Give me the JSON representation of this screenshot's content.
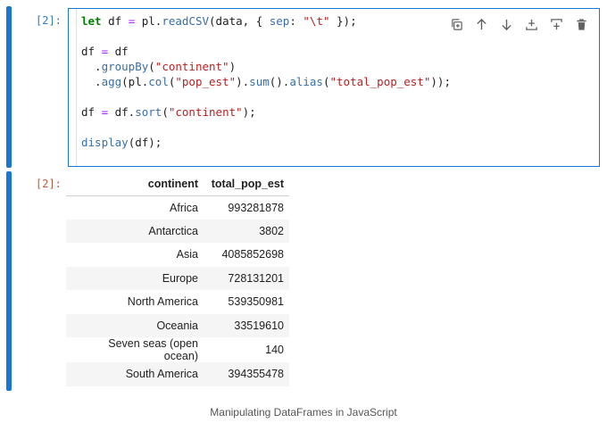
{
  "input_cell": {
    "prompt": "[2]:",
    "code_lines": [
      [
        {
          "t": "let",
          "c": "kw"
        },
        {
          "t": " df "
        },
        {
          "t": "=",
          "c": "op"
        },
        {
          "t": " pl."
        },
        {
          "t": "readCSV",
          "c": "fn"
        },
        {
          "t": "(data, { "
        },
        {
          "t": "sep",
          "c": "fn"
        },
        {
          "t": ": "
        },
        {
          "t": "\"\\t\"",
          "c": "st"
        },
        {
          "t": " });"
        }
      ],
      [
        {
          "t": ""
        }
      ],
      [
        {
          "t": "df "
        },
        {
          "t": "=",
          "c": "op"
        },
        {
          "t": " df"
        }
      ],
      [
        {
          "t": "  ."
        },
        {
          "t": "groupBy",
          "c": "fn"
        },
        {
          "t": "("
        },
        {
          "t": "\"continent\"",
          "c": "st"
        },
        {
          "t": ")"
        }
      ],
      [
        {
          "t": "  ."
        },
        {
          "t": "agg",
          "c": "fn"
        },
        {
          "t": "(pl."
        },
        {
          "t": "col",
          "c": "fn"
        },
        {
          "t": "("
        },
        {
          "t": "\"pop_est\"",
          "c": "st"
        },
        {
          "t": ")."
        },
        {
          "t": "sum",
          "c": "fn"
        },
        {
          "t": "()."
        },
        {
          "t": "alias",
          "c": "fn"
        },
        {
          "t": "("
        },
        {
          "t": "\"total_pop_est\"",
          "c": "st"
        },
        {
          "t": "));"
        }
      ],
      [
        {
          "t": ""
        }
      ],
      [
        {
          "t": "df "
        },
        {
          "t": "=",
          "c": "op"
        },
        {
          "t": " df."
        },
        {
          "t": "sort",
          "c": "fn"
        },
        {
          "t": "("
        },
        {
          "t": "\"continent\"",
          "c": "st"
        },
        {
          "t": ");"
        }
      ],
      [
        {
          "t": ""
        }
      ],
      [
        {
          "t": "display",
          "c": "fn"
        },
        {
          "t": "(df);"
        }
      ]
    ]
  },
  "toolbar": {
    "icons": [
      "duplicate-icon",
      "move-up-icon",
      "move-down-icon",
      "insert-below-icon",
      "insert-above-icon",
      "delete-icon"
    ]
  },
  "output_cell": {
    "prompt": "[2]:",
    "columns": [
      "continent",
      "total_pop_est"
    ],
    "rows": [
      [
        "Africa",
        "993281878"
      ],
      [
        "Antarctica",
        "3802"
      ],
      [
        "Asia",
        "4085852698"
      ],
      [
        "Europe",
        "728131201"
      ],
      [
        "North America",
        "539350981"
      ],
      [
        "Oceania",
        "33519610"
      ],
      [
        "Seven seas (open ocean)",
        "140"
      ],
      [
        "South America",
        "394355478"
      ]
    ]
  },
  "caption": "Manipulating DataFrames in JavaScript",
  "colors": {
    "accent": "#1976d2",
    "prompt_in": "#307fc1",
    "prompt_out": "#bf5b3d",
    "icon": "#616161"
  }
}
